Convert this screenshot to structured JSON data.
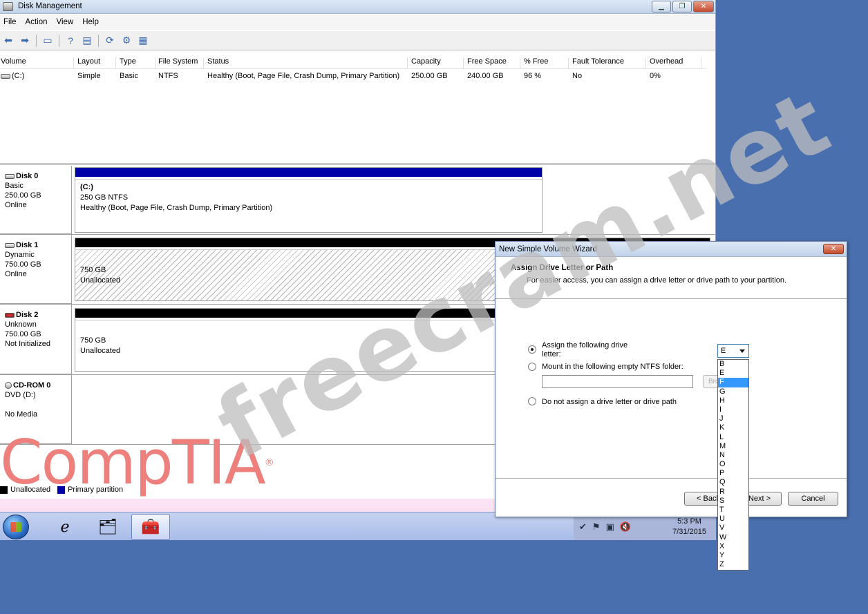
{
  "window": {
    "title": "Disk Management",
    "menu": [
      "File",
      "Action",
      "View",
      "Help"
    ]
  },
  "volumes": {
    "columns": [
      "Volume",
      "Layout",
      "Type",
      "File System",
      "Status",
      "Capacity",
      "Free Space",
      "% Free",
      "Fault Tolerance",
      "Overhead"
    ],
    "rows": [
      [
        "(C:)",
        "Simple",
        "Basic",
        "NTFS",
        "Healthy (Boot, Page File, Crash Dump, Primary Partition)",
        "250.00 GB",
        "240.00 GB",
        "96 %",
        "No",
        "0%"
      ]
    ]
  },
  "disks": [
    {
      "name": "Disk 0",
      "type": "Basic",
      "size": "250.00 GB",
      "state": "Online",
      "part_title": "(C:)",
      "part_size": "250 GB NTFS",
      "part_status": "Healthy (Boot, Page File, Crash Dump, Primary Partition)"
    },
    {
      "name": "Disk 1",
      "type": "Dynamic",
      "size": "750.00 GB",
      "state": "Online",
      "part_size": "750 GB",
      "part_status": "Unallocated"
    },
    {
      "name": "Disk 2",
      "type": "Unknown",
      "size": "750.00 GB",
      "state": "Not Initialized",
      "part_size": "750 GB",
      "part_status": "Unallocated"
    },
    {
      "name": "CD-ROM 0",
      "type": "DVD (D:)",
      "state": "No Media"
    }
  ],
  "legend": {
    "unallocated": "Unallocated",
    "primary": "Primary partition"
  },
  "colors": {
    "primary": "#0000a8",
    "unallocated": "#000000",
    "accent": "#3399ff"
  },
  "overlays": {
    "watermark": "freecram.net",
    "logo": "CompTIA"
  },
  "taskbar": {
    "time": "5:3 PM",
    "date": "7/31/2015"
  },
  "wizard": {
    "title": "New Simple Volume Wizard",
    "heading": "Assign Drive Letter or Path",
    "subheading": "For easier access, you can assign a drive letter or drive path to your partition.",
    "opt_assign": "Assign the following drive letter:",
    "opt_mount": "Mount in the following empty NTFS folder:",
    "opt_none": "Do not assign a drive letter or drive path",
    "browse": "Bro",
    "back": "< Back",
    "next": "Next >",
    "cancel": "Cancel",
    "selected_letter": "E",
    "letters": [
      "B",
      "E",
      "F",
      "G",
      "H",
      "I",
      "J",
      "K",
      "L",
      "M",
      "N",
      "O",
      "P",
      "Q",
      "R",
      "S",
      "T",
      "U",
      "V",
      "W",
      "X",
      "Y",
      "Z"
    ],
    "highlighted": "F"
  }
}
